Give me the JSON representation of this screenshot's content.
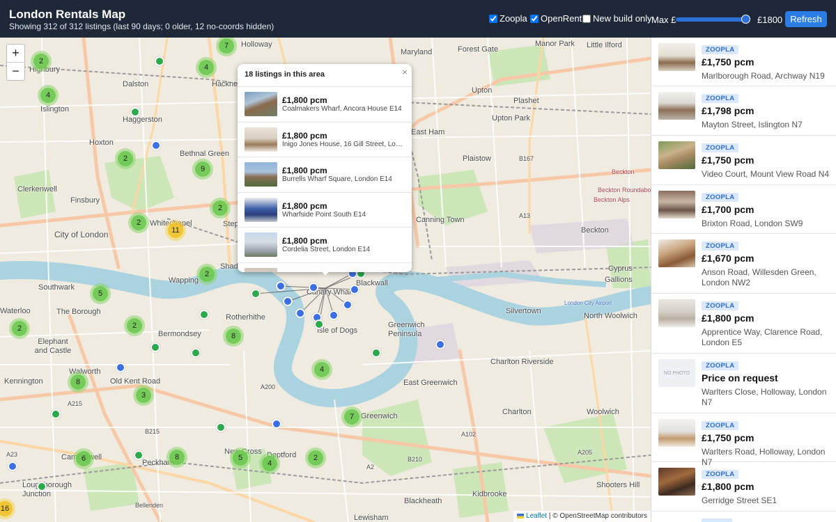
{
  "header": {
    "title": "London Rentals Map",
    "subtitle": "Showing 312 of 312 listings (last 90 days; 0 older, 12 no-coords hidden)",
    "filters": {
      "zoopla": {
        "label": "Zoopla",
        "checked": true
      },
      "openrent": {
        "label": "OpenRent",
        "checked": true
      },
      "new_build": {
        "label": "New build only",
        "checked": false
      }
    },
    "max_price_label": "Max £",
    "max_price_value": "£1800",
    "max_price_fraction": 1.0,
    "refresh_label": "Refresh"
  },
  "colors": {
    "header_bg": "#1e2838",
    "accent": "#2a7de4",
    "marker_blue": "#3b6fe3",
    "marker_green": "#2ba94b",
    "cluster_green": "#8ad66a",
    "cluster_yellow": "#f0c228",
    "river": "#aad3df"
  },
  "map": {
    "zoom_in": "+",
    "zoom_out": "−",
    "place_labels": [
      "Holloway",
      "Maryland",
      "Forest Gate",
      "Manor Park",
      "Little Ilford",
      "Highbury",
      "Dalston",
      "Hackney",
      "Upton",
      "Plashet",
      "Islington",
      "Haggerston",
      "Upton Park",
      "East Ham",
      "Hoxton",
      "Bethnal Green",
      "Plaistow",
      "B167",
      "Beckton",
      "Clerkenwell",
      "Finsbury",
      "Beckton Roundabout",
      "Beckton Alps",
      "Whitechapel",
      "Stepney",
      "A13",
      "City of London",
      "Canning Town",
      "Beckton",
      "Shadwell",
      "Cyprus",
      "Wapping",
      "Blackwall",
      "Gallions",
      "Southwark",
      "Canary Wharf",
      "London City Airport",
      "Silvertown",
      "North Woolwich",
      "Waterloo",
      "The Borough",
      "Rotherhithe",
      "Isle of Dogs",
      "Greenwich Peninsula",
      "Elephant and Castle",
      "Bermondsey",
      "Charlton Riverside",
      "Walworth",
      "Old Kent Road",
      "East Greenwich",
      "Kennington",
      "A200",
      "A215",
      "Charlton",
      "Woolwich",
      "Greenwich",
      "B215",
      "Camberwell",
      "A102",
      "Peckham",
      "New Cross",
      "Deptford",
      "A2",
      "B210",
      "A205",
      "A23",
      "Loughborough Junction",
      "Shooters Hill",
      "Blackheath",
      "Kidbrooke",
      "Bellenden",
      "Lewisham"
    ],
    "clusters": [
      {
        "count": "7",
        "color": "green"
      },
      {
        "count": "2",
        "color": "green"
      },
      {
        "count": "4",
        "color": "green"
      },
      {
        "count": "4",
        "color": "green"
      },
      {
        "count": "2",
        "color": "green"
      },
      {
        "count": "9",
        "color": "green"
      },
      {
        "count": "2",
        "color": "green"
      },
      {
        "count": "2",
        "color": "green"
      },
      {
        "count": "11",
        "color": "yellow"
      },
      {
        "count": "2",
        "color": "green"
      },
      {
        "count": "5",
        "color": "green"
      },
      {
        "count": "2",
        "color": "green"
      },
      {
        "count": "2",
        "color": "green"
      },
      {
        "count": "8",
        "color": "green"
      },
      {
        "count": "4",
        "color": "green"
      },
      {
        "count": "8",
        "color": "green"
      },
      {
        "count": "3",
        "color": "green"
      },
      {
        "count": "7",
        "color": "green"
      },
      {
        "count": "6",
        "color": "green"
      },
      {
        "count": "8",
        "color": "green"
      },
      {
        "count": "5",
        "color": "green"
      },
      {
        "count": "4",
        "color": "green"
      },
      {
        "count": "2",
        "color": "green"
      },
      {
        "count": "16",
        "color": "yellow"
      }
    ],
    "popup": {
      "title": "18 listings in this area",
      "close": "×",
      "items": [
        {
          "price": "£1,800 pcm",
          "address": "Coalmakers Wharf, Ancora House E14"
        },
        {
          "price": "£1,800 pcm",
          "address": "Inigo Jones House, 16 Gill Street, London E14"
        },
        {
          "price": "£1,800 pcm",
          "address": "Burrells Wharf Square, London E14"
        },
        {
          "price": "£1,800 pcm",
          "address": "Wharfside Point South E14"
        },
        {
          "price": "£1,800 pcm",
          "address": "Cordelia Street, London E14"
        }
      ]
    },
    "attribution": {
      "leaflet": "Leaflet",
      "rest": " | © OpenStreetMap contributors"
    }
  },
  "sidebar": {
    "listings": [
      {
        "source": "ZOOPLA",
        "price": "£1,750 pcm",
        "address": "Marlborough Road, Archway N19"
      },
      {
        "source": "ZOOPLA",
        "price": "£1,798 pcm",
        "address": "Mayton Street, Islington N7"
      },
      {
        "source": "ZOOPLA",
        "price": "£1,750 pcm",
        "address": "Video Court, Mount View Road N4"
      },
      {
        "source": "ZOOPLA",
        "price": "£1,700 pcm",
        "address": "Brixton Road, London SW9"
      },
      {
        "source": "ZOOPLA",
        "price": "£1,670 pcm",
        "address": "Anson Road, Willesden Green, London NW2"
      },
      {
        "source": "ZOOPLA",
        "price": "£1,800 pcm",
        "address": "Apprentice Way, Clarence Road, London E5"
      },
      {
        "source": "ZOOPLA",
        "price": "Price on request",
        "address": "Warlters Close, Holloway, London N7",
        "photo": "NO PHOTO"
      },
      {
        "source": "ZOOPLA",
        "price": "£1,750 pcm",
        "address": "Warlters Road, Holloway, London N7"
      },
      {
        "source": "ZOOPLA",
        "price": "£1,800 pcm",
        "address": "Gerridge Street SE1"
      }
    ]
  }
}
